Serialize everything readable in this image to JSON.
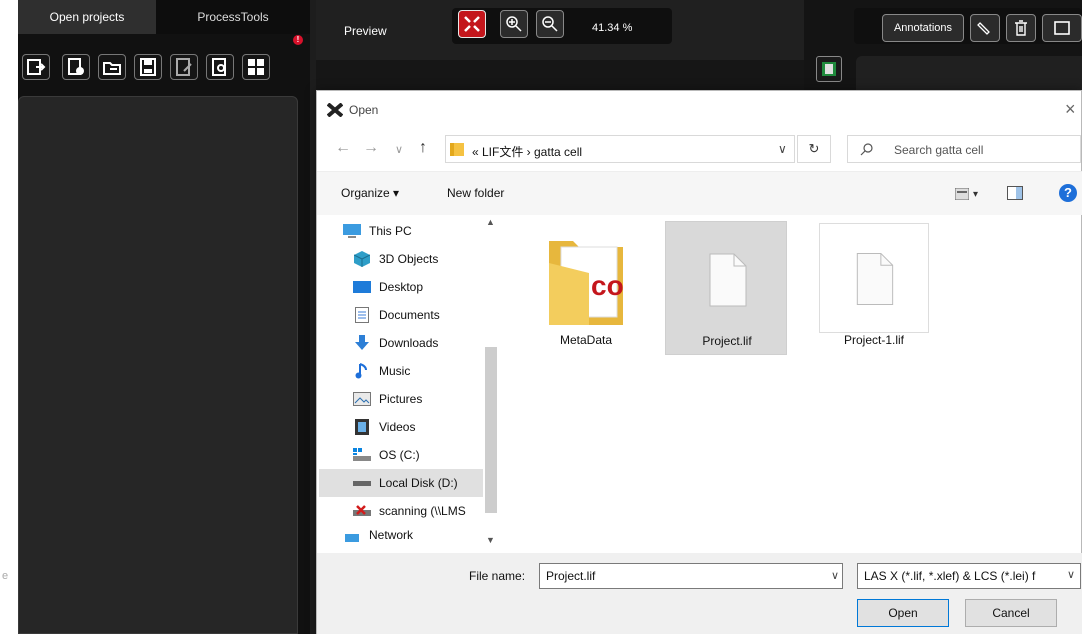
{
  "left_panel": {
    "tabs": [
      "Open projects",
      "ProcessTools"
    ],
    "alert_badge": "!",
    "toolbar_icons": [
      "open-project-icon",
      "new-project-icon",
      "import-icon",
      "save-icon",
      "save-as-icon",
      "search-project-icon",
      "grid-icon"
    ]
  },
  "ghost_text": "e",
  "preview": {
    "label": "Preview",
    "zoom": "41.34 %",
    "buttons": [
      "fit-to-window-icon",
      "zoom-in-icon",
      "zoom-out-icon"
    ]
  },
  "right_toolbar": {
    "annotations_label": "Annotations"
  },
  "dialog": {
    "title": "Open",
    "close_glyph": "×",
    "nav": {
      "back": "←",
      "forward": "→",
      "recent": "∨",
      "up": "↑"
    },
    "address": {
      "crumbs": "« LIF文件 › gatta cell",
      "dropdown": "∨",
      "refresh": "↻"
    },
    "search_placeholder": "Search gatta cell",
    "commands": {
      "organize": "Organize ▾",
      "new_folder": "New folder",
      "view_arrow": "▾",
      "help": "?"
    },
    "nav_items": [
      {
        "label": "This PC",
        "icon": "pc-icon"
      },
      {
        "label": "3D Objects",
        "icon": "3d-objects-icon"
      },
      {
        "label": "Desktop",
        "icon": "desktop-icon"
      },
      {
        "label": "Documents",
        "icon": "documents-icon"
      },
      {
        "label": "Downloads",
        "icon": "downloads-icon"
      },
      {
        "label": "Music",
        "icon": "music-icon"
      },
      {
        "label": "Pictures",
        "icon": "pictures-icon"
      },
      {
        "label": "Videos",
        "icon": "videos-icon"
      },
      {
        "label": "OS (C:)",
        "icon": "os-drive-icon"
      },
      {
        "label": "Local Disk (D:)",
        "icon": "local-disk-icon"
      },
      {
        "label": "scanning (\\\\LMS",
        "icon": "network-drive-icon"
      },
      {
        "label": "Network",
        "icon": "network-icon"
      }
    ],
    "files": [
      {
        "name": "MetaData",
        "type": "folder"
      },
      {
        "name": "Project.lif",
        "type": "file",
        "selected": true
      },
      {
        "name": "Project-1.lif",
        "type": "file"
      }
    ],
    "file_name_label": "File name:",
    "file_name_value": "Project.lif",
    "file_type": "LAS X (*.lif, *.xlef) & LCS (*.lei) f",
    "open_label": "Open",
    "cancel_label": "Cancel"
  },
  "colors": {
    "app_bg": "#1d1d1d",
    "accent_red": "#c4161c",
    "selection": "#d9d9d9",
    "help_blue": "#1e6fd9"
  }
}
